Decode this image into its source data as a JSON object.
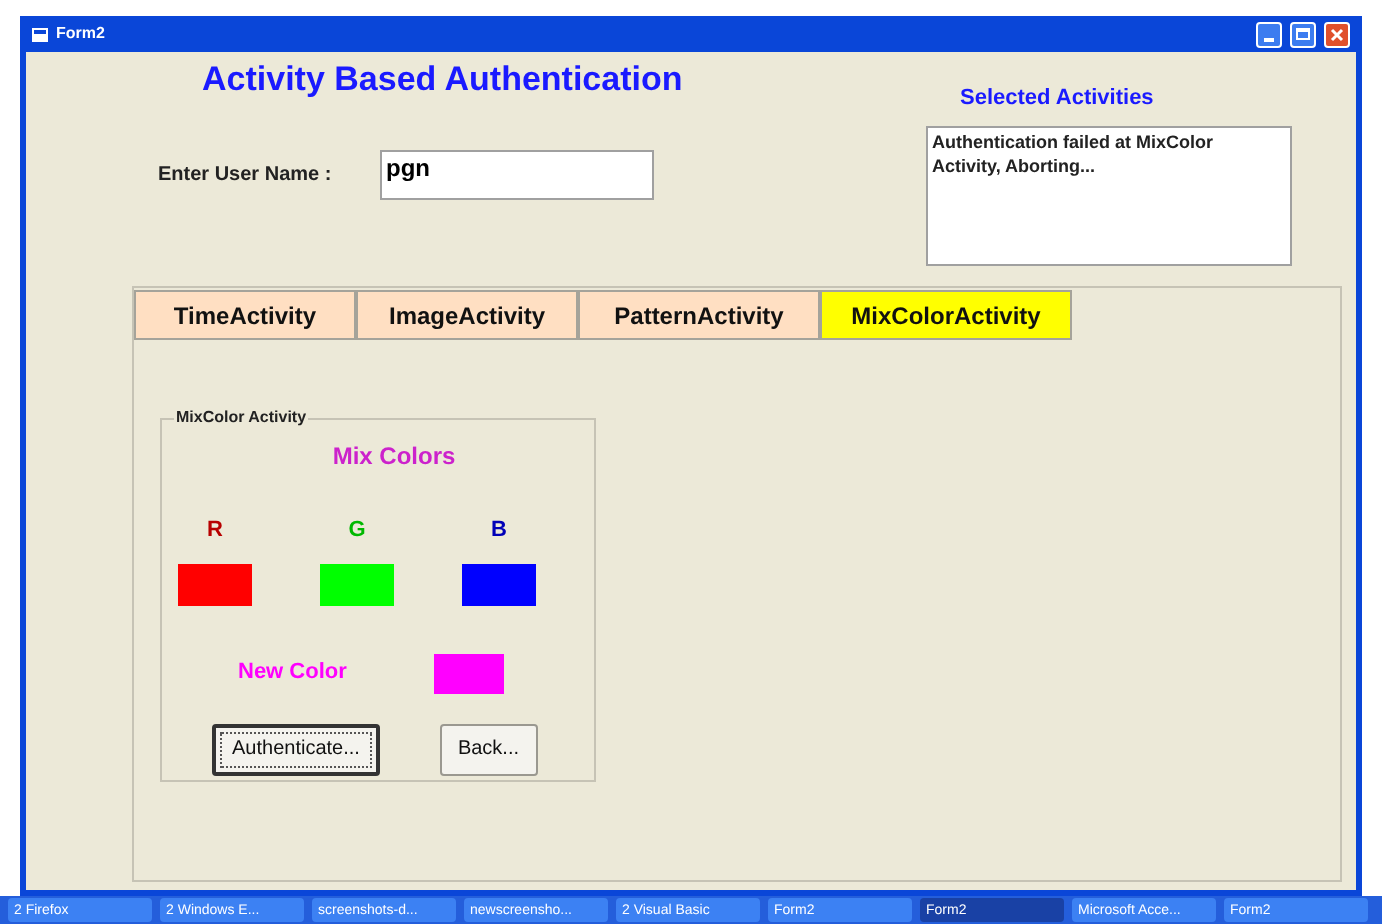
{
  "window": {
    "title": "Form2"
  },
  "heading": "Activity Based Authentication",
  "user_name": {
    "label": "Enter User Name :",
    "value": "pgn"
  },
  "selected_activities": {
    "label": "Selected Activities",
    "text": "Authentication failed at MixColor Activity, Aborting..."
  },
  "tabs": [
    {
      "label": "TimeActivity",
      "selected": false
    },
    {
      "label": "ImageActivity",
      "selected": false
    },
    {
      "label": "PatternActivity",
      "selected": false
    },
    {
      "label": "MixColorActivity",
      "selected": true
    }
  ],
  "group": {
    "title": "MixColor Activity",
    "heading": "Mix Colors",
    "channels": [
      {
        "label": "R",
        "color": "#ff0000"
      },
      {
        "label": "G",
        "color": "#00ff00"
      },
      {
        "label": "B",
        "color": "#0000ff"
      }
    ],
    "new_color": {
      "label": "New Color",
      "color": "#ff00ff"
    },
    "buttons": [
      {
        "label": "Authenticate...",
        "selected": true
      },
      {
        "label": "Back...",
        "selected": false
      }
    ]
  },
  "taskbar": [
    {
      "label": "2 Firefox",
      "selected": false
    },
    {
      "label": "2 Windows E...",
      "selected": false
    },
    {
      "label": "screenshots-d...",
      "selected": false
    },
    {
      "label": "newscreensho...",
      "selected": false
    },
    {
      "label": "2 Visual Basic",
      "selected": false
    },
    {
      "label": "Form2",
      "selected": false
    },
    {
      "label": "Form2",
      "selected": true
    },
    {
      "label": "Microsoft Acce...",
      "selected": false
    },
    {
      "label": "Form2",
      "selected": false
    }
  ]
}
